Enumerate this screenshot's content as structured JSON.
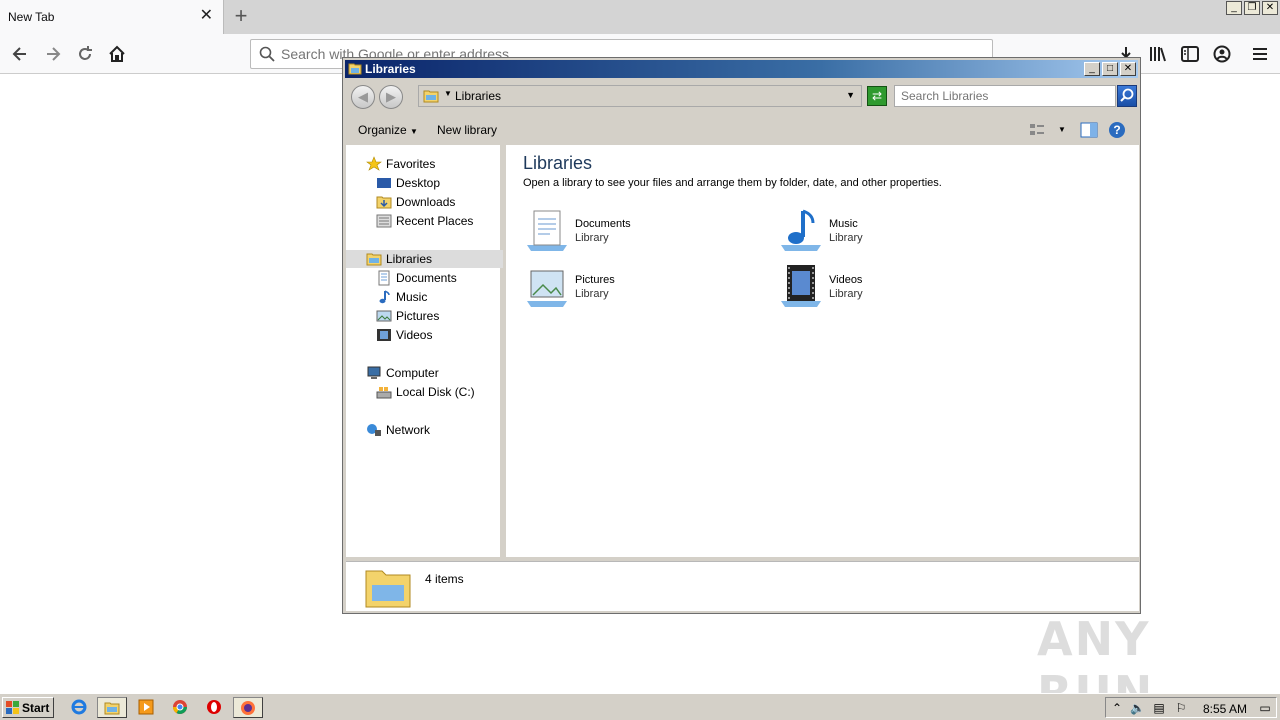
{
  "browser": {
    "tab_title": "New Tab",
    "tab_close": "✕",
    "new_tab": "+",
    "url_placeholder": "Search with Google or enter address"
  },
  "explorer": {
    "window_title": "Libraries",
    "address_label": "Libraries",
    "search_placeholder": "Search Libraries",
    "toolbar": {
      "organize": "Organize",
      "new_library": "New library"
    },
    "nav": {
      "favorites": "Favorites",
      "desktop": "Desktop",
      "downloads": "Downloads",
      "recent_places": "Recent Places",
      "libraries": "Libraries",
      "documents": "Documents",
      "music": "Music",
      "pictures": "Pictures",
      "videos": "Videos",
      "computer": "Computer",
      "local_disk": "Local Disk (C:)",
      "network": "Network"
    },
    "content": {
      "title": "Libraries",
      "description": "Open a library to see your files and arrange them by folder, date, and other properties.",
      "items": [
        {
          "name": "Documents",
          "sub": "Library"
        },
        {
          "name": "Music",
          "sub": "Library"
        },
        {
          "name": "Pictures",
          "sub": "Library"
        },
        {
          "name": "Videos",
          "sub": "Library"
        }
      ]
    },
    "status": "4 items"
  },
  "taskbar": {
    "start": "Start",
    "clock": "8:55 AM"
  },
  "watermark": "ANY RUN"
}
